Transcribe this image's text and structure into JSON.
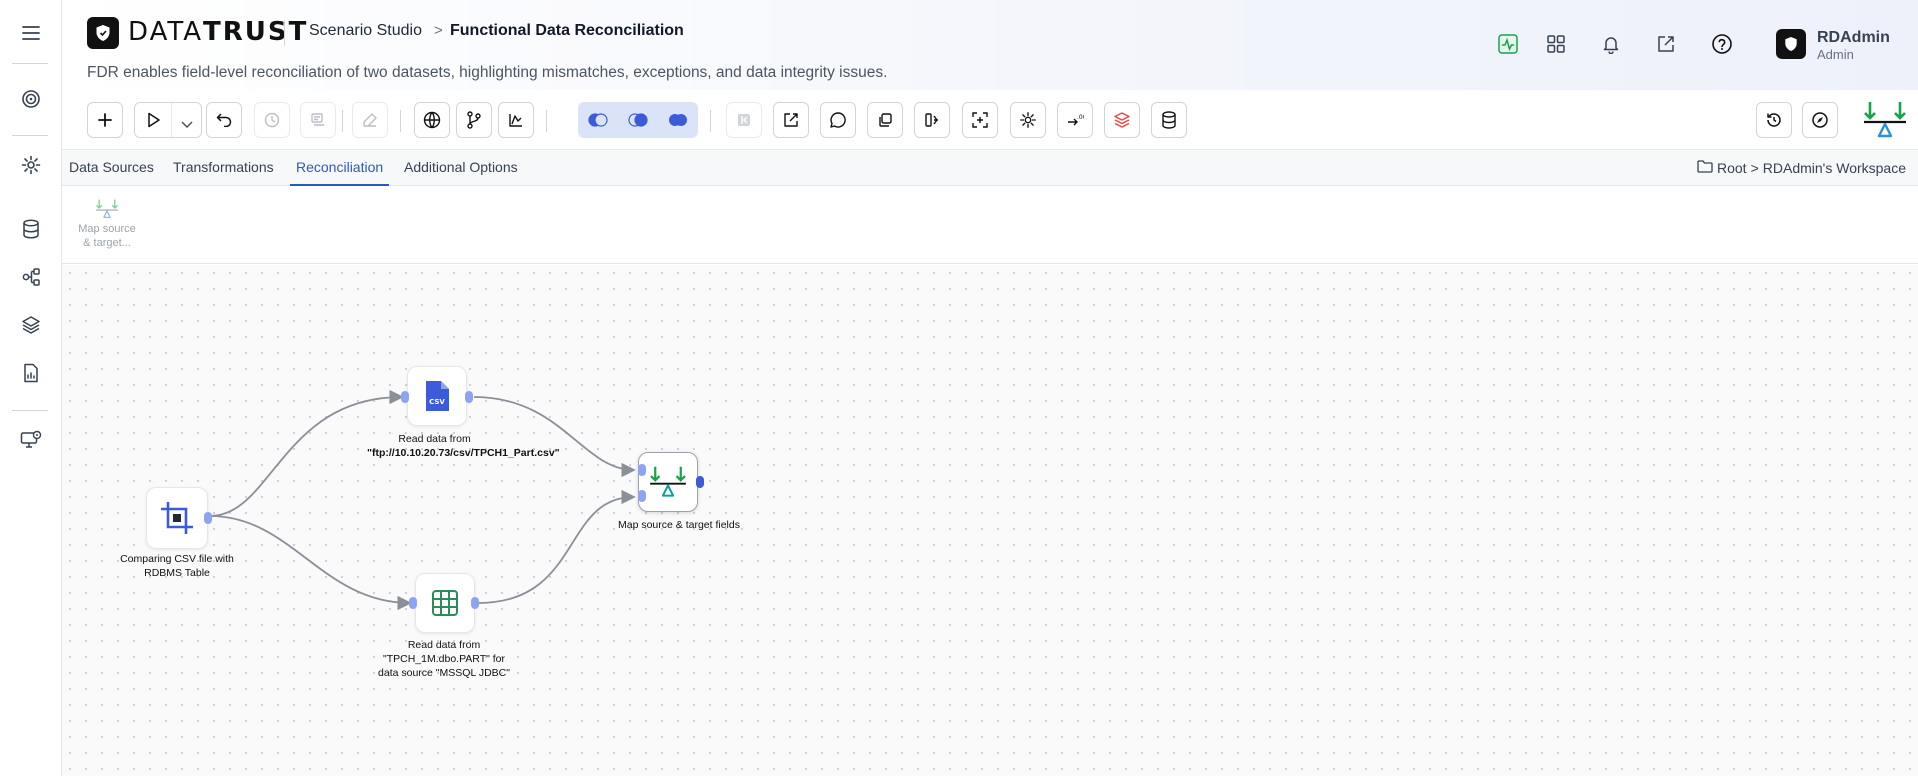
{
  "brand": {
    "name_bold": "DATA",
    "name_light": "TRUST"
  },
  "breadcrumb": {
    "parent": "Scenario Studio",
    "separator": ">",
    "current": "Functional Data Reconciliation"
  },
  "subtitle": "FDR enables field-level reconciliation of two datasets, highlighting mismatches, exceptions, and data integrity issues.",
  "user": {
    "name": "RDAdmin",
    "role": "Admin"
  },
  "header_icons": [
    "activity-icon",
    "apps-grid-icon",
    "bell-icon",
    "external-link-icon",
    "help-icon"
  ],
  "left_nav": [
    "menu-icon",
    "target-icon",
    "settings-icon",
    "database-icon",
    "workflow-icon",
    "layers-icon",
    "report-icon",
    "monitor-settings-icon"
  ],
  "tabs": [
    {
      "label": "Data Sources",
      "active": false
    },
    {
      "label": "Transformations",
      "active": false
    },
    {
      "label": "Reconciliation",
      "active": true
    },
    {
      "label": "Additional Options",
      "active": false
    }
  ],
  "path": {
    "root": "Root",
    "separator": ">",
    "workspace": "RDAdmin's Workspace"
  },
  "palette": {
    "item_label_line1": "Map source",
    "item_label_line2": "& target..."
  },
  "nodes": {
    "source": {
      "label": "Comparing CSV file with RDBMS Table"
    },
    "csv": {
      "prefix": "Read data from ",
      "value": "\"ftp://10.10.20.73/csv/TPCH1_Part.csv\"",
      "badge": "CSV"
    },
    "table": {
      "label": "Read data from \"TPCH_1M.dbo.PART\" for data source \"MSSQL JDBC\""
    },
    "map": {
      "label": "Map source & target fields"
    }
  },
  "colors": {
    "accent": "#2b59c3",
    "port": "#8ea4f2",
    "green": "#16a34a",
    "teal": "#0e9f9a"
  }
}
